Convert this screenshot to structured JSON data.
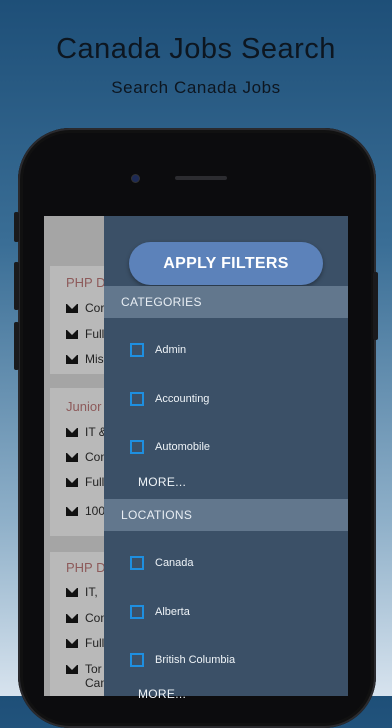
{
  "promo": {
    "headline": "Canada Jobs Search",
    "subline": "Search Canada Jobs"
  },
  "job_list": [
    {
      "title": "PHP De",
      "lines": [
        "Cor",
        "Full",
        "Mis"
      ]
    },
    {
      "title": "Junior",
      "lines": [
        "IT &",
        "Con",
        "Full",
        "100"
      ]
    },
    {
      "title": "PHP De",
      "lines": [
        "IT,",
        "Con",
        "Full",
        "Tor\nCan"
      ]
    }
  ],
  "filters": {
    "apply_label": "APPLY FILTERS",
    "categories_header": "CATEGORIES",
    "categories": [
      "Admin",
      "Accounting",
      "Automobile"
    ],
    "categories_more": "MORE...",
    "locations_header": "LOCATIONS",
    "locations": [
      "Canada",
      "Alberta",
      "British Columbia"
    ],
    "locations_more": "MORE..."
  },
  "colors": {
    "drawer_bg": "#3b5067",
    "section_header_bg": "#62778d",
    "apply_button_bg": "#5c82ba",
    "checkbox_border": "#1e8fe0"
  },
  "icons": [
    "envelope-icon"
  ]
}
